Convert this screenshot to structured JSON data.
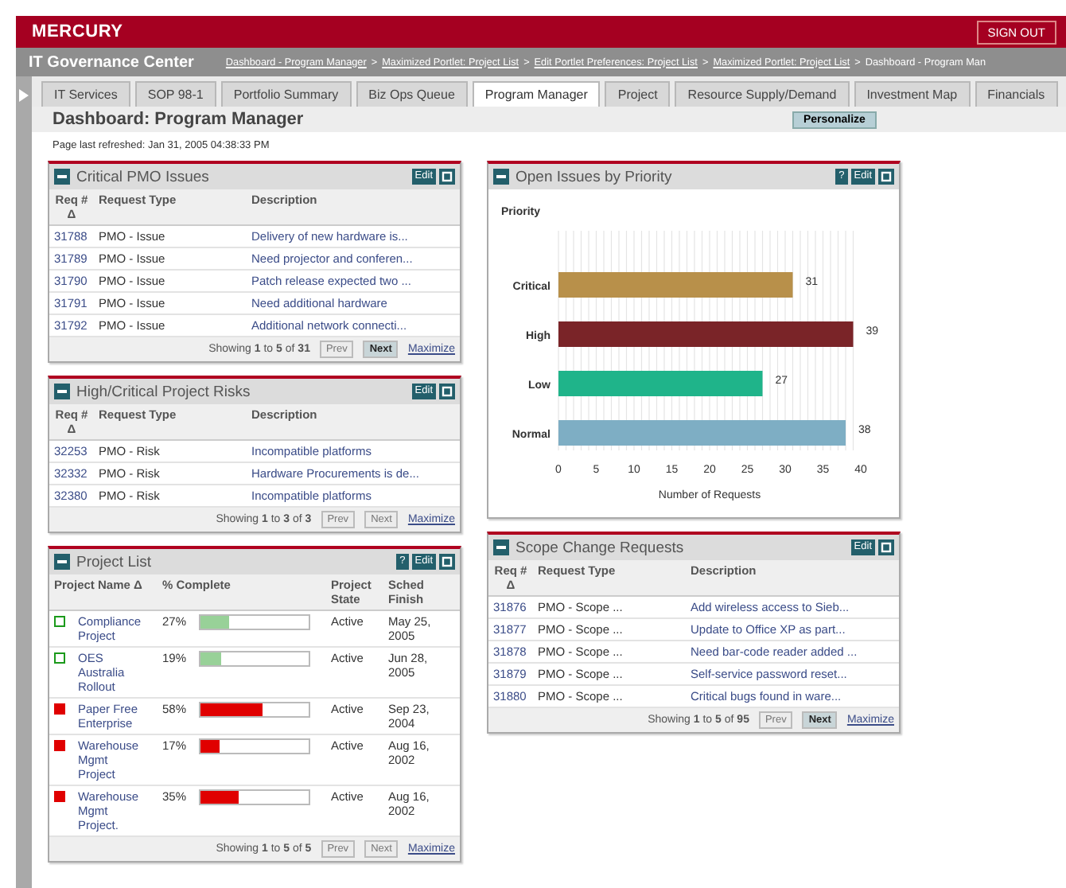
{
  "header": {
    "logo": "MERCURY",
    "sign_out": "SIGN OUT",
    "app_title": "IT Governance Center",
    "breadcrumb": [
      {
        "text": "Dashboard - Program Manager",
        "link": true
      },
      {
        "text": "Maximized Portlet: Project List",
        "link": true
      },
      {
        "text": "Edit Portlet Preferences: Project List",
        "link": true
      },
      {
        "text": "Maximized Portlet: Project List",
        "link": true
      },
      {
        "text": "Dashboard - Program Man",
        "link": false
      }
    ],
    "separator": ">"
  },
  "tabs": [
    {
      "label": "IT Services",
      "selected": false
    },
    {
      "label": "SOP 98-1",
      "selected": false
    },
    {
      "label": "Portfolio Summary",
      "selected": false
    },
    {
      "label": "Biz Ops Queue",
      "selected": false
    },
    {
      "label": "Program Manager",
      "selected": true
    },
    {
      "label": "Project",
      "selected": false
    },
    {
      "label": "Resource Supply/Demand",
      "selected": false
    },
    {
      "label": "Investment Map",
      "selected": false
    },
    {
      "label": "Financials",
      "selected": false
    }
  ],
  "page_title": "Dashboard: Program Manager",
  "personalize": "Personalize",
  "refreshed": "Page last refreshed: Jan 31, 2005 04:38:33 PM",
  "left": [
    {
      "kind": "requests",
      "title": "Critical PMO Issues",
      "buttons": [
        "Edit"
      ],
      "columns": [
        "Req # Δ",
        "Request Type",
        "Description"
      ],
      "rows": [
        [
          "31788",
          "PMO - Issue",
          "Delivery of new hardware is..."
        ],
        [
          "31789",
          "PMO - Issue",
          "Need projector and conferen..."
        ],
        [
          "31790",
          "PMO - Issue",
          "Patch release expected two ..."
        ],
        [
          "31791",
          "PMO - Issue",
          "Need additional hardware"
        ],
        [
          "31792",
          "PMO - Issue",
          "Additional network connecti..."
        ]
      ],
      "footer": {
        "showing": "Showing **1** to **5** of **31**",
        "prev": "Prev",
        "prev_disabled": true,
        "next": "Next",
        "next_disabled": false,
        "maximize": "Maximize"
      }
    },
    {
      "kind": "requests",
      "title": "High/Critical Project Risks",
      "buttons": [
        "Edit"
      ],
      "columns": [
        "Req # Δ",
        "Request Type",
        "Description"
      ],
      "rows": [
        [
          "32253",
          "PMO - Risk",
          "Incompatible platforms"
        ],
        [
          "32332",
          "PMO - Risk",
          "Hardware Procurements is de..."
        ],
        [
          "32380",
          "PMO - Risk",
          "Incompatible platforms"
        ]
      ],
      "footer": {
        "showing": "Showing **1** to **3** of **3**",
        "prev": "Prev",
        "prev_disabled": true,
        "next": "Next",
        "next_disabled": true,
        "maximize": "Maximize"
      }
    },
    {
      "kind": "projects",
      "title": "Project List",
      "buttons": [
        "?",
        "Edit"
      ],
      "columns": [
        "Project Name Δ",
        "% Complete",
        "Project State",
        "Sched Finish"
      ],
      "projects": [
        {
          "color": "#1b9a1b",
          "filled": false,
          "name": "Compliance Project",
          "percent": "27%",
          "level": 0.27,
          "state": "Active",
          "finish": "May 25, 2005"
        },
        {
          "color": "#1b9a1b",
          "filled": false,
          "name": "OES Australia Rollout",
          "percent": "19%",
          "level": 0.19,
          "state": "Active",
          "finish": "Jun 28, 2005"
        },
        {
          "color": "#e00000",
          "filled": true,
          "name": "Paper Free Enterprise",
          "percent": "58%",
          "level": 0.58,
          "state": "Active",
          "finish": "Sep 23, 2004"
        },
        {
          "color": "#e00000",
          "filled": true,
          "name": "Warehouse Mgmt Project",
          "percent": "17%",
          "level": 0.17,
          "state": "Active",
          "finish": "Aug 16, 2002"
        },
        {
          "color": "#e00000",
          "filled": true,
          "name": "Warehouse Mgmt Project.",
          "percent": "35%",
          "level": 0.35,
          "state": "Active",
          "finish": "Aug 16, 2002"
        }
      ],
      "footer": {
        "showing": "Showing **1** to **5** of **5**",
        "prev": "Prev",
        "prev_disabled": true,
        "next": "Next",
        "next_disabled": true,
        "maximize": "Maximize"
      }
    }
  ],
  "right": [
    {
      "kind": "chart",
      "title": "Open Issues by Priority",
      "buttons": [
        "?",
        "Edit"
      ],
      "chart_data": {
        "type": "bar",
        "orientation": "horizontal",
        "annotations": [
          {
            "text": "Priority"
          }
        ],
        "grid": true,
        "xlabel": "Number of Requests",
        "categories": [
          "Critical",
          "High",
          "Low",
          "Normal"
        ],
        "series": [
          {
            "values": [
              31,
              39,
              27,
              38
            ],
            "colors": [
              "#b8904a",
              "#7a2428",
              "#1fb48a",
              "#7eaec4"
            ]
          }
        ],
        "xlim": [
          0,
          40
        ],
        "xticks": [
          0,
          5,
          10,
          15,
          20,
          25,
          30,
          35,
          40
        ],
        "data_labels": true
      }
    },
    {
      "kind": "requests",
      "title": "Scope Change Requests",
      "buttons": [
        "Edit"
      ],
      "columns": [
        "Req # Δ",
        "Request Type",
        "Description"
      ],
      "rows": [
        [
          "31876",
          "PMO - Scope ...",
          "Add wireless access to Sieb..."
        ],
        [
          "31877",
          "PMO - Scope ...",
          "Update to Office XP as part..."
        ],
        [
          "31878",
          "PMO - Scope ...",
          "Need bar-code reader added ..."
        ],
        [
          "31879",
          "PMO - Scope ...",
          "Self-service password reset..."
        ],
        [
          "31880",
          "PMO - Scope ...",
          "Critical bugs found in ware..."
        ]
      ],
      "footer": {
        "showing": "Showing **1** to **5** of **95**",
        "prev": "Prev",
        "prev_disabled": true,
        "next": "Next",
        "next_disabled": false,
        "maximize": "Maximize"
      }
    }
  ]
}
